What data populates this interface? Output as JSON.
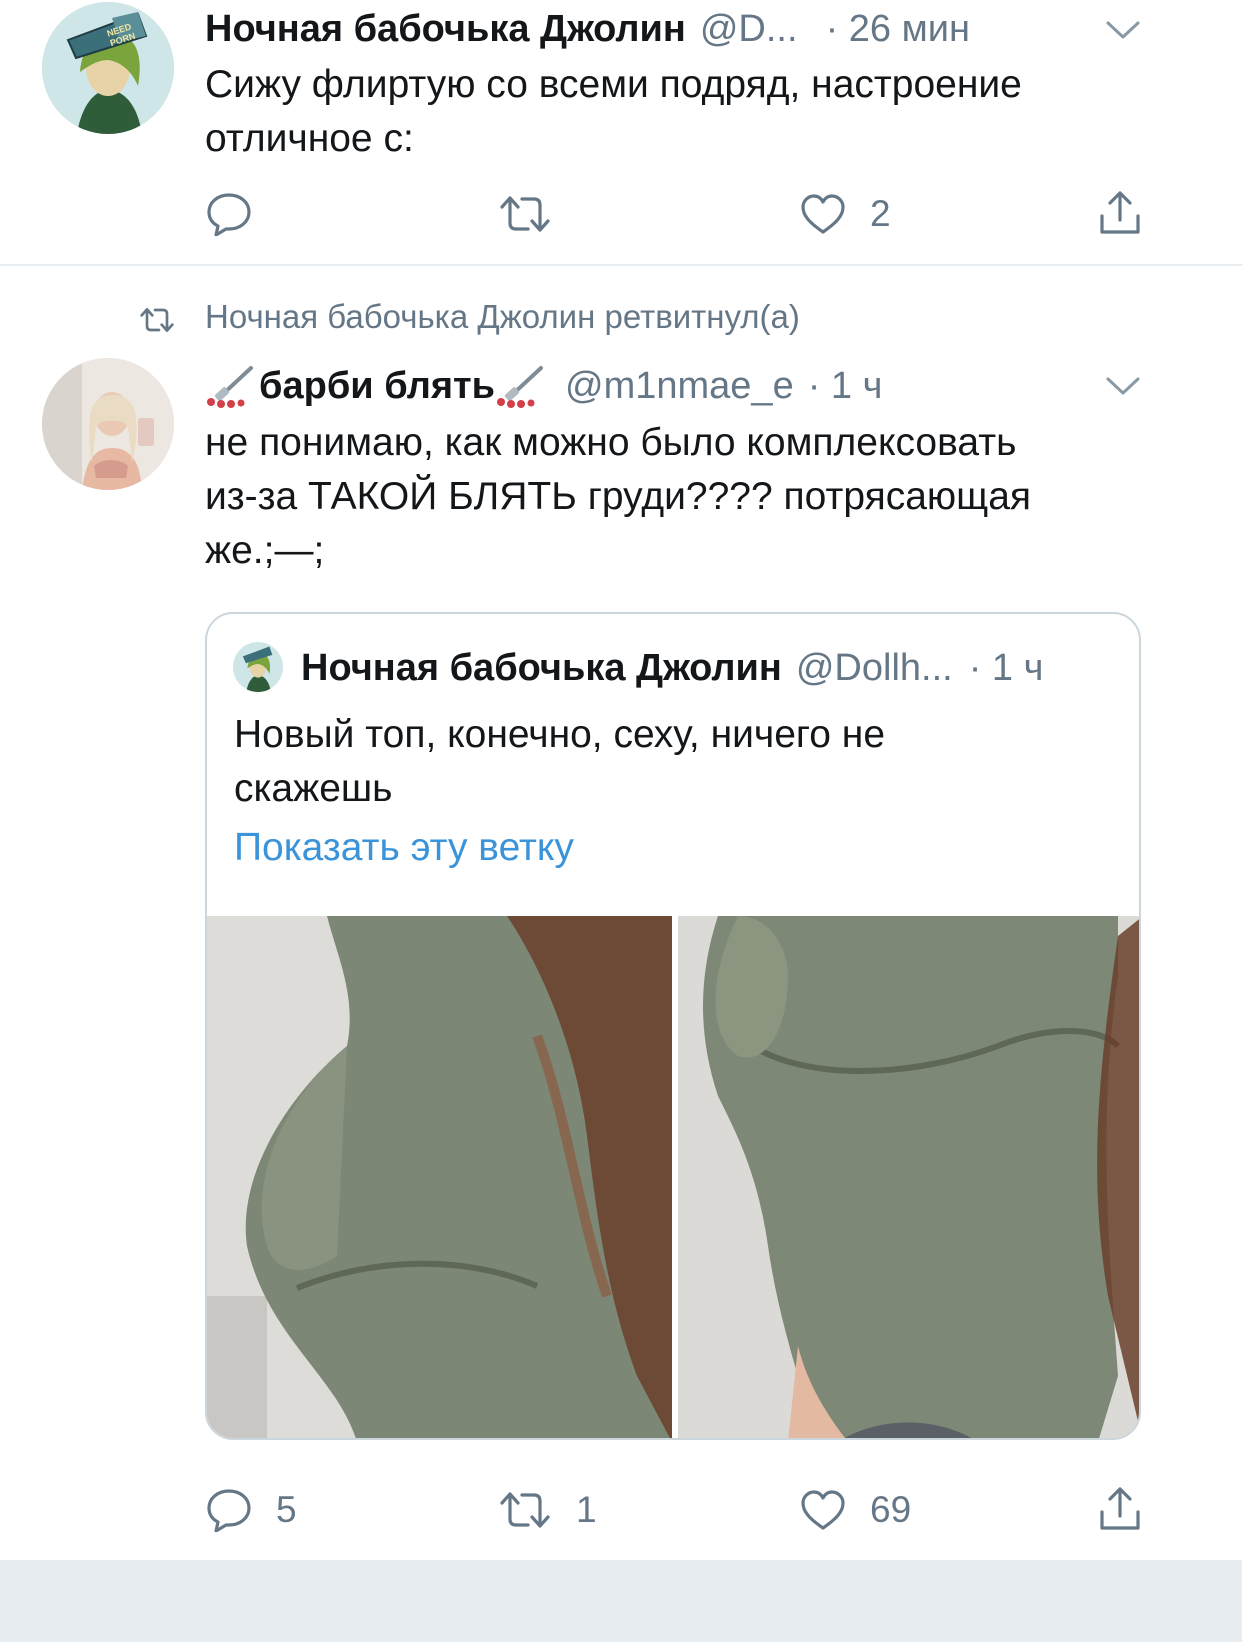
{
  "tweet1": {
    "name": "Ночная бабочька Джолин",
    "handle": "@D...",
    "time": "· 26 мин",
    "text_lines": [
      "Сижу флиртую со всеми подряд, настроение",
      "отличное с:"
    ],
    "replies": "",
    "retweets": "",
    "likes": "2",
    "avatar_badge": "NEED PORN"
  },
  "tweet2": {
    "retweet_banner": "Ночная бабочька Джолин ретвитнул(а)",
    "name": "барби блять",
    "handle": "@m1nmae_e",
    "time": "· 1 ч",
    "text_lines": [
      "не понимаю, как можно было комплексовать",
      "из-за ТАКОЙ БЛЯТЬ груди???? потрясающая",
      "же.;—;"
    ],
    "replies": "5",
    "retweets": "1",
    "likes": "69",
    "quote": {
      "name": "Ночная бабочька Джолин",
      "handle": "@Dollh...",
      "time": "· 1 ч",
      "text_lines": [
        "Новый топ, конечно, сеху, ничего не",
        "скажешь"
      ],
      "show_thread": "Показать эту ветку"
    }
  },
  "colors": {
    "accent": "#1da1f2",
    "link": "#3b94d9",
    "muted": "#657786",
    "border": "#ccd6dd"
  },
  "icons": [
    "reply-icon",
    "retweet-icon",
    "like-icon",
    "share-icon",
    "chevron-down-icon",
    "needle-emoji-icon"
  ]
}
